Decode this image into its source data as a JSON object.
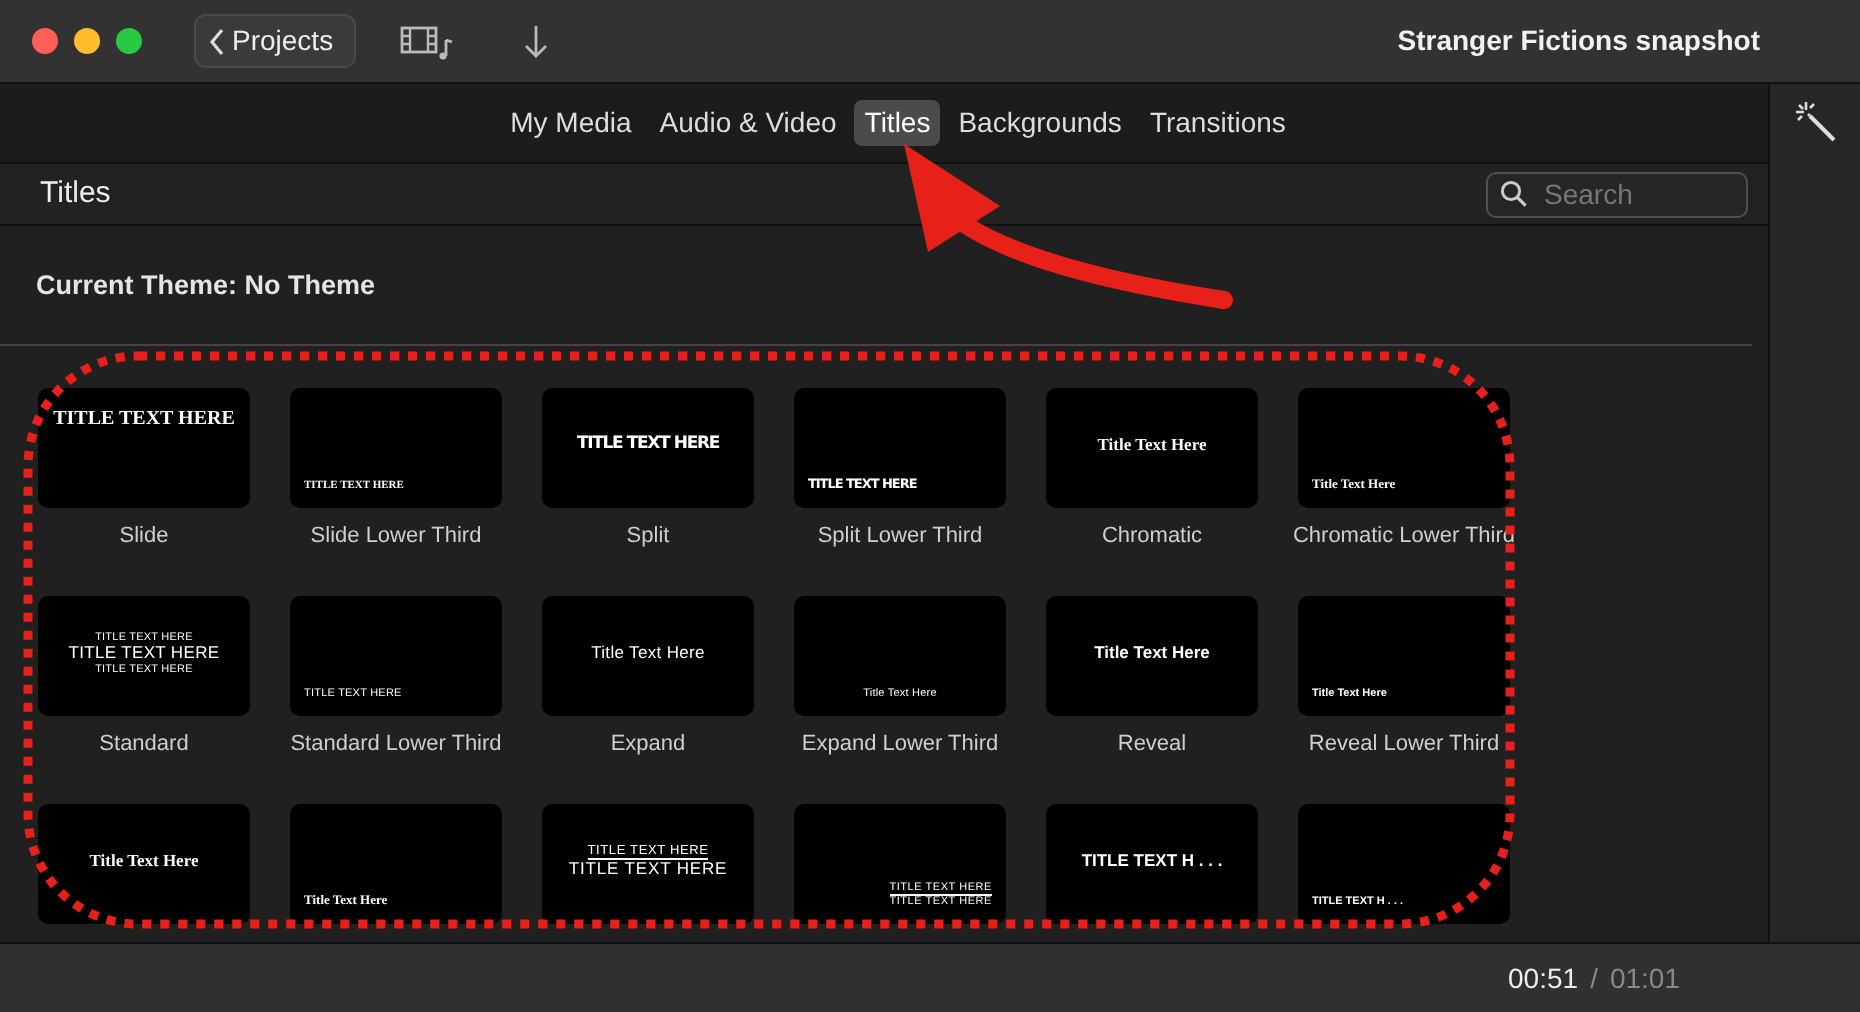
{
  "window": {
    "title": "Stranger Fictions snapshot",
    "back_button": "Projects"
  },
  "tabs": [
    {
      "label": "My Media",
      "selected": false
    },
    {
      "label": "Audio & Video",
      "selected": false
    },
    {
      "label": "Titles",
      "selected": true
    },
    {
      "label": "Backgrounds",
      "selected": false
    },
    {
      "label": "Transitions",
      "selected": false
    }
  ],
  "browser": {
    "heading": "Titles",
    "search": {
      "placeholder": "Search"
    },
    "theme": "Current Theme: No Theme"
  },
  "titles": [
    {
      "name": "Slide",
      "kind": "slide",
      "preview": [
        "TITLE TEXT HERE"
      ]
    },
    {
      "name": "Slide Lower Third",
      "kind": "slidelower",
      "preview": [
        "TITLE TEXT HERE"
      ]
    },
    {
      "name": "Split",
      "kind": "split",
      "preview": [
        "TITLE TEXT HERE"
      ]
    },
    {
      "name": "Split Lower Third",
      "kind": "splitlower",
      "preview": [
        "TITLE TEXT HERE"
      ]
    },
    {
      "name": "Chromatic",
      "kind": "chromatic",
      "preview": [
        "Title Text Here"
      ]
    },
    {
      "name": "Chromatic Lower Third",
      "kind": "chromaticlower",
      "preview": [
        "Title Text Here"
      ]
    },
    {
      "name": "Standard",
      "kind": "standard",
      "preview": [
        "TITLE TEXT HERE",
        "TITLE TEXT HERE",
        "TITLE TEXT HERE"
      ]
    },
    {
      "name": "Standard Lower Third",
      "kind": "standardlower",
      "preview": [
        "TITLE TEXT HERE"
      ]
    },
    {
      "name": "Expand",
      "kind": "expand",
      "preview": [
        "Title Text Here"
      ]
    },
    {
      "name": "Expand Lower Third",
      "kind": "expandlower",
      "preview": [
        "Title Text Here"
      ]
    },
    {
      "name": "Reveal",
      "kind": "reveal",
      "preview": [
        "Title Text Here"
      ]
    },
    {
      "name": "Reveal Lower Third",
      "kind": "reveallower",
      "preview": [
        "Title Text Here"
      ]
    },
    {
      "kind": "focus",
      "preview": [
        "Title Text Here"
      ]
    },
    {
      "kind": "focuslower",
      "preview": [
        "Title Text Here"
      ]
    },
    {
      "kind": "line",
      "preview": [
        "TITLE TEXT HERE",
        "TITLE TEXT HERE"
      ]
    },
    {
      "kind": "linelower",
      "preview": [
        "TITLE TEXT HERE",
        "TITLE TEXT HERE"
      ]
    },
    {
      "kind": "popup",
      "preview": [
        "TITLE TEXT H . . ."
      ]
    },
    {
      "kind": "popuplower",
      "preview": [
        "TITLE TEXT H . . ."
      ]
    }
  ],
  "player": {
    "current_time": "00:51",
    "separator": "/",
    "duration": "01:01"
  }
}
